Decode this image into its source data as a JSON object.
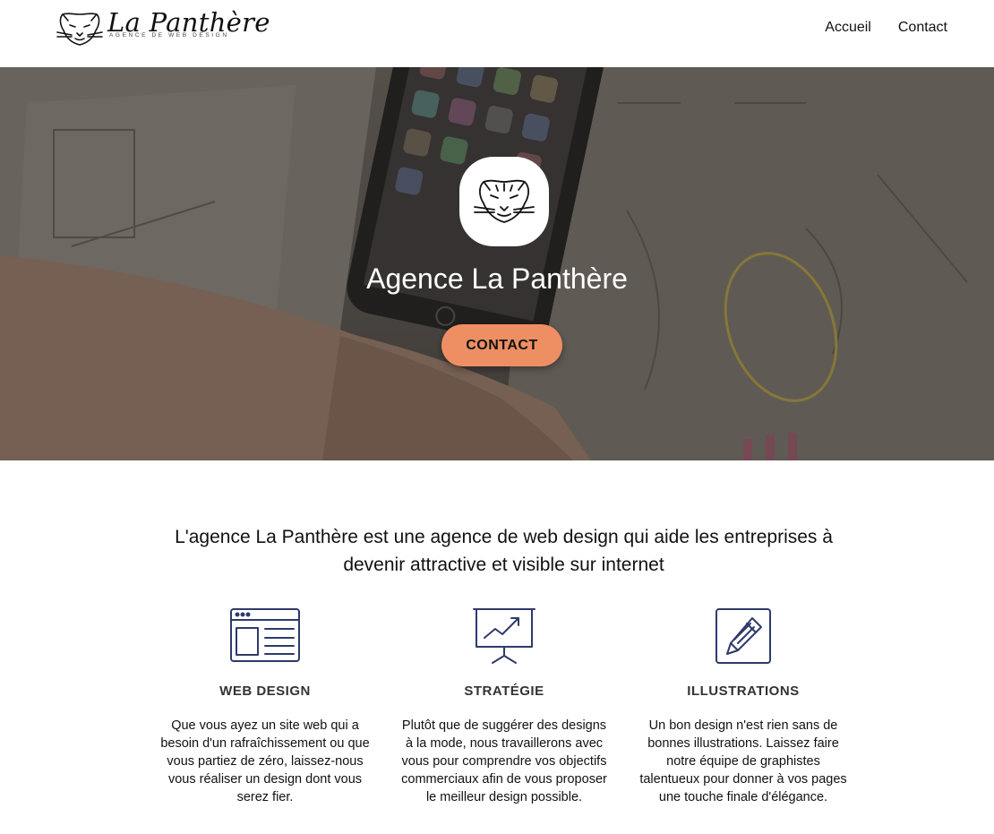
{
  "header": {
    "logo_title": "La Panthère",
    "logo_subtitle": "AGENCE DE WEB DESIGN",
    "nav": [
      {
        "label": "Accueil"
      },
      {
        "label": "Contact"
      }
    ]
  },
  "hero": {
    "title": "Agence La Panthère",
    "button_label": "CONTACT",
    "badge_icon": "panther-head-icon"
  },
  "intro": {
    "text": "L'agence La Panthère est une agence de web design qui aide les entreprises à devenir attractive et visible sur internet"
  },
  "features": [
    {
      "icon": "browser-layout-icon",
      "title": "WEB DESIGN",
      "text": "Que vous ayez un site web qui a besoin d'un rafraîchissement ou que vous partiez de zéro, laissez-nous vous réaliser un design dont vous serez fier."
    },
    {
      "icon": "presentation-chart-icon",
      "title": "STRATÉGIE",
      "text": "Plutôt que de suggérer des designs à la mode, nous travaillerons avec vous pour comprendre vos objectifs commerciaux afin de vous proposer le meilleur design possible."
    },
    {
      "icon": "pencil-edit-icon",
      "title": "ILLUSTRATIONS",
      "text": "Un bon design n'est rien sans de bonnes illustrations. Laissez faire notre équipe de graphistes talentueux pour donner à vos pages une touche finale d'élégance."
    }
  ],
  "colors": {
    "accent": "#ee8f63",
    "icon_stroke": "#2e3a6b"
  }
}
